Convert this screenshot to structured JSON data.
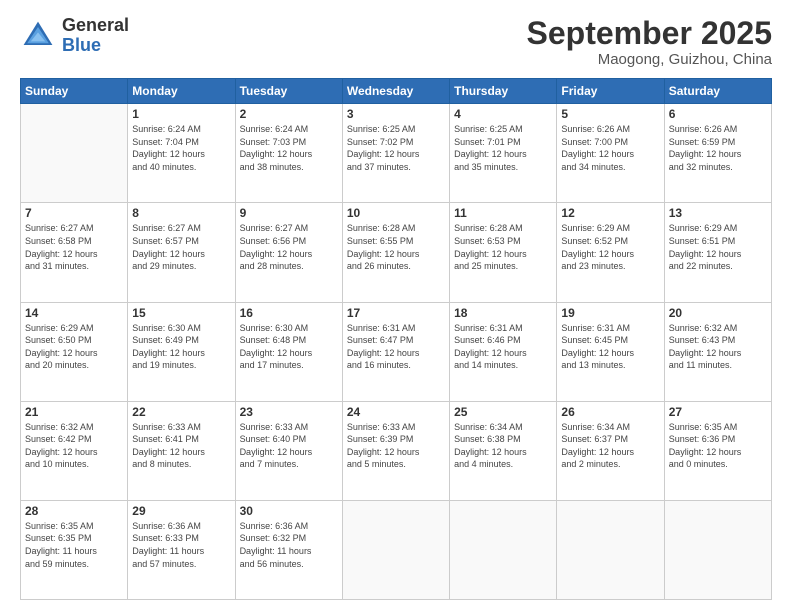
{
  "header": {
    "logo_general": "General",
    "logo_blue": "Blue",
    "month_title": "September 2025",
    "location": "Maogong, Guizhou, China"
  },
  "weekdays": [
    "Sunday",
    "Monday",
    "Tuesday",
    "Wednesday",
    "Thursday",
    "Friday",
    "Saturday"
  ],
  "weeks": [
    [
      {
        "day": "",
        "info": ""
      },
      {
        "day": "1",
        "info": "Sunrise: 6:24 AM\nSunset: 7:04 PM\nDaylight: 12 hours\nand 40 minutes."
      },
      {
        "day": "2",
        "info": "Sunrise: 6:24 AM\nSunset: 7:03 PM\nDaylight: 12 hours\nand 38 minutes."
      },
      {
        "day": "3",
        "info": "Sunrise: 6:25 AM\nSunset: 7:02 PM\nDaylight: 12 hours\nand 37 minutes."
      },
      {
        "day": "4",
        "info": "Sunrise: 6:25 AM\nSunset: 7:01 PM\nDaylight: 12 hours\nand 35 minutes."
      },
      {
        "day": "5",
        "info": "Sunrise: 6:26 AM\nSunset: 7:00 PM\nDaylight: 12 hours\nand 34 minutes."
      },
      {
        "day": "6",
        "info": "Sunrise: 6:26 AM\nSunset: 6:59 PM\nDaylight: 12 hours\nand 32 minutes."
      }
    ],
    [
      {
        "day": "7",
        "info": "Sunrise: 6:27 AM\nSunset: 6:58 PM\nDaylight: 12 hours\nand 31 minutes."
      },
      {
        "day": "8",
        "info": "Sunrise: 6:27 AM\nSunset: 6:57 PM\nDaylight: 12 hours\nand 29 minutes."
      },
      {
        "day": "9",
        "info": "Sunrise: 6:27 AM\nSunset: 6:56 PM\nDaylight: 12 hours\nand 28 minutes."
      },
      {
        "day": "10",
        "info": "Sunrise: 6:28 AM\nSunset: 6:55 PM\nDaylight: 12 hours\nand 26 minutes."
      },
      {
        "day": "11",
        "info": "Sunrise: 6:28 AM\nSunset: 6:53 PM\nDaylight: 12 hours\nand 25 minutes."
      },
      {
        "day": "12",
        "info": "Sunrise: 6:29 AM\nSunset: 6:52 PM\nDaylight: 12 hours\nand 23 minutes."
      },
      {
        "day": "13",
        "info": "Sunrise: 6:29 AM\nSunset: 6:51 PM\nDaylight: 12 hours\nand 22 minutes."
      }
    ],
    [
      {
        "day": "14",
        "info": "Sunrise: 6:29 AM\nSunset: 6:50 PM\nDaylight: 12 hours\nand 20 minutes."
      },
      {
        "day": "15",
        "info": "Sunrise: 6:30 AM\nSunset: 6:49 PM\nDaylight: 12 hours\nand 19 minutes."
      },
      {
        "day": "16",
        "info": "Sunrise: 6:30 AM\nSunset: 6:48 PM\nDaylight: 12 hours\nand 17 minutes."
      },
      {
        "day": "17",
        "info": "Sunrise: 6:31 AM\nSunset: 6:47 PM\nDaylight: 12 hours\nand 16 minutes."
      },
      {
        "day": "18",
        "info": "Sunrise: 6:31 AM\nSunset: 6:46 PM\nDaylight: 12 hours\nand 14 minutes."
      },
      {
        "day": "19",
        "info": "Sunrise: 6:31 AM\nSunset: 6:45 PM\nDaylight: 12 hours\nand 13 minutes."
      },
      {
        "day": "20",
        "info": "Sunrise: 6:32 AM\nSunset: 6:43 PM\nDaylight: 12 hours\nand 11 minutes."
      }
    ],
    [
      {
        "day": "21",
        "info": "Sunrise: 6:32 AM\nSunset: 6:42 PM\nDaylight: 12 hours\nand 10 minutes."
      },
      {
        "day": "22",
        "info": "Sunrise: 6:33 AM\nSunset: 6:41 PM\nDaylight: 12 hours\nand 8 minutes."
      },
      {
        "day": "23",
        "info": "Sunrise: 6:33 AM\nSunset: 6:40 PM\nDaylight: 12 hours\nand 7 minutes."
      },
      {
        "day": "24",
        "info": "Sunrise: 6:33 AM\nSunset: 6:39 PM\nDaylight: 12 hours\nand 5 minutes."
      },
      {
        "day": "25",
        "info": "Sunrise: 6:34 AM\nSunset: 6:38 PM\nDaylight: 12 hours\nand 4 minutes."
      },
      {
        "day": "26",
        "info": "Sunrise: 6:34 AM\nSunset: 6:37 PM\nDaylight: 12 hours\nand 2 minutes."
      },
      {
        "day": "27",
        "info": "Sunrise: 6:35 AM\nSunset: 6:36 PM\nDaylight: 12 hours\nand 0 minutes."
      }
    ],
    [
      {
        "day": "28",
        "info": "Sunrise: 6:35 AM\nSunset: 6:35 PM\nDaylight: 11 hours\nand 59 minutes."
      },
      {
        "day": "29",
        "info": "Sunrise: 6:36 AM\nSunset: 6:33 PM\nDaylight: 11 hours\nand 57 minutes."
      },
      {
        "day": "30",
        "info": "Sunrise: 6:36 AM\nSunset: 6:32 PM\nDaylight: 11 hours\nand 56 minutes."
      },
      {
        "day": "",
        "info": ""
      },
      {
        "day": "",
        "info": ""
      },
      {
        "day": "",
        "info": ""
      },
      {
        "day": "",
        "info": ""
      }
    ]
  ]
}
